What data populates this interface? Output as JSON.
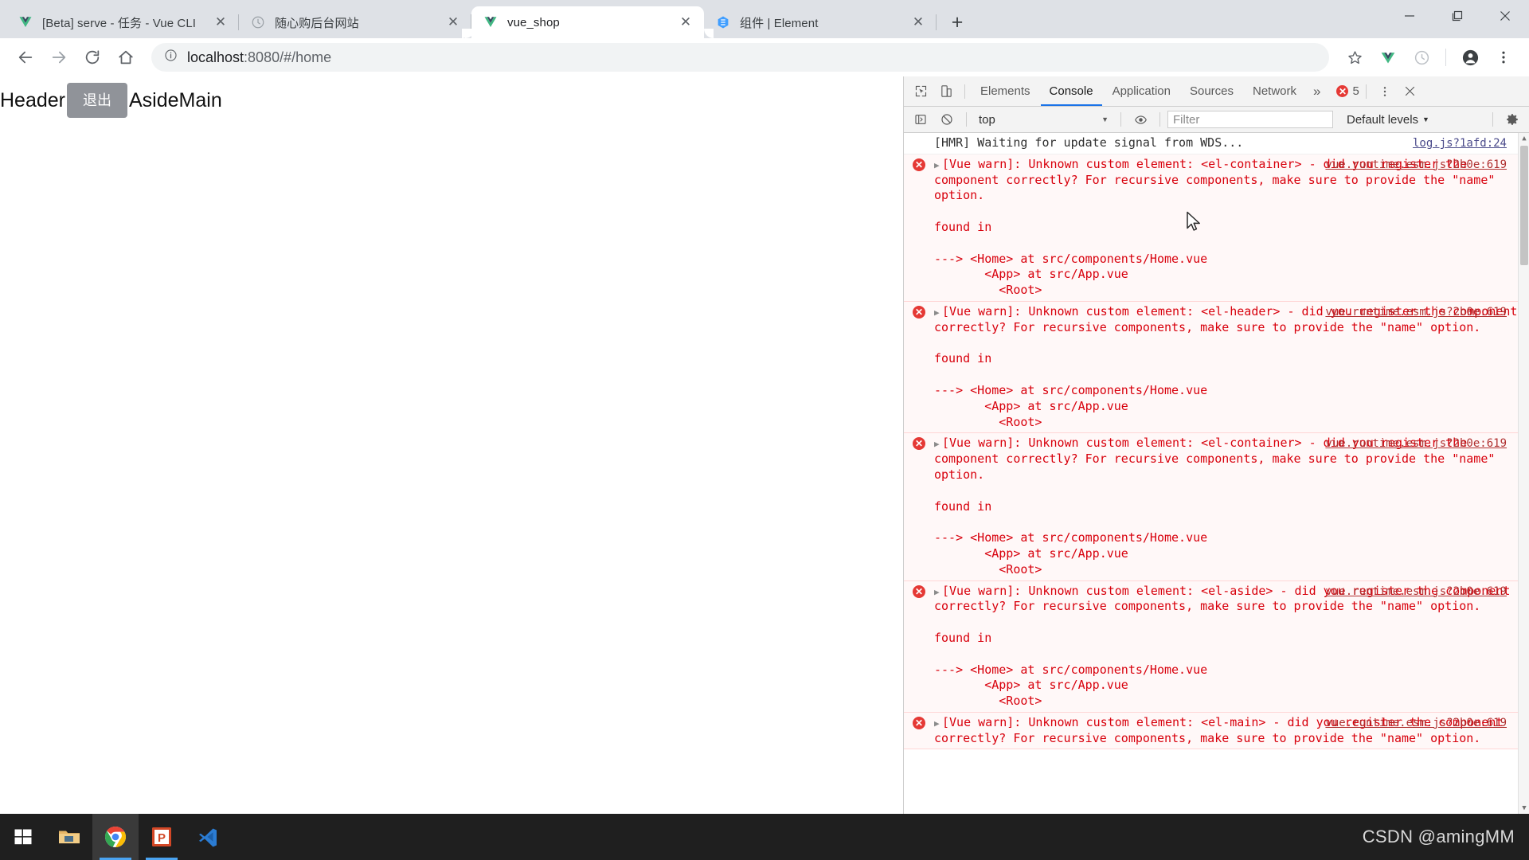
{
  "browser": {
    "tabs": [
      {
        "title": "[Beta] serve - 任务 - Vue CLI",
        "favicon": "vue-icon",
        "active": false
      },
      {
        "title": "随心购后台网站",
        "favicon": "clock-icon",
        "active": false
      },
      {
        "title": "vue_shop",
        "favicon": "vue-icon",
        "active": true
      },
      {
        "title": "组件 | Element",
        "favicon": "element-icon",
        "active": false
      }
    ],
    "newtab_label": "+",
    "window_controls": {
      "minimize": "—",
      "maximize": "❐",
      "close": "✕"
    },
    "toolbar": {
      "back": "←",
      "forward": "→",
      "reload": "⟳",
      "home": "⌂",
      "site_info": "ⓘ",
      "url_host": "localhost",
      "url_path": ":8080/#/home",
      "bookmark": "☆",
      "ext_vue": "vue-devtools-icon",
      "ext_clock": "clock-extension-icon",
      "profile": "profile-avatar",
      "menu": "⋮"
    }
  },
  "page": {
    "header_text": "Header",
    "logout_label": "退出",
    "body_text": "AsideMain"
  },
  "devtools": {
    "inspect_icon": "inspect-element-icon",
    "device_icon": "device-toolbar-icon",
    "panels": [
      "Elements",
      "Console",
      "Application",
      "Sources",
      "Network"
    ],
    "active_panel": "Console",
    "more_panels": "»",
    "error_count": "5",
    "error_badge_glyph": "✕",
    "settings_icon": "⋮",
    "close_icon": "✕",
    "filterbar": {
      "sidebar_toggle": "console-sidebar-icon",
      "clear_icon": "clear-console-icon",
      "context": "top",
      "context_caret": "▼",
      "eye_icon": "live-expression-icon",
      "filter_placeholder": "Filter",
      "filter_value": "",
      "levels": "Default levels",
      "levels_caret": "▼",
      "settings_gear": "settings-gear-icon"
    },
    "messages": [
      {
        "type": "info",
        "text": "[HMR] Waiting for update signal from WDS...",
        "source": "log.js?1afd:24",
        "has_arrow": false
      },
      {
        "type": "warn",
        "text": "[Vue warn]: Unknown custom element: <el-container> - did you register the component correctly? For recursive components, make sure to provide the \"name\" option.\n\nfound in\n\n---> <Home> at src/components/Home.vue\n       <App> at src/App.vue\n         <Root>",
        "source": "vue.runtime.esm.js?2b0e:619",
        "has_arrow": true
      },
      {
        "type": "warn",
        "text": "[Vue warn]: Unknown custom element: <el-header> - did you register the component correctly? For recursive components, make sure to provide the \"name\" option.\n\nfound in\n\n---> <Home> at src/components/Home.vue\n       <App> at src/App.vue\n         <Root>",
        "source": "vue.runtime.esm.js?2b0e:619",
        "has_arrow": true
      },
      {
        "type": "warn",
        "text": "[Vue warn]: Unknown custom element: <el-container> - did you register the component correctly? For recursive components, make sure to provide the \"name\" option.\n\nfound in\n\n---> <Home> at src/components/Home.vue\n       <App> at src/App.vue\n         <Root>",
        "source": "vue.runtime.esm.js?2b0e:619",
        "has_arrow": true
      },
      {
        "type": "warn",
        "text": "[Vue warn]: Unknown custom element: <el-aside> - did you register the component correctly? For recursive components, make sure to provide the \"name\" option.\n\nfound in\n\n---> <Home> at src/components/Home.vue\n       <App> at src/App.vue\n         <Root>",
        "source": "vue.runtime.esm.js?2b0e:619",
        "has_arrow": true
      },
      {
        "type": "warn",
        "text": "[Vue warn]: Unknown custom element: <el-main> - did you register the component correctly? For recursive components, make sure to provide the \"name\" option.",
        "source": "vue.runtime.esm.js?2b0e:619",
        "has_arrow": true
      }
    ]
  },
  "taskbar": {
    "items": [
      {
        "name": "start-button",
        "glyph": "windows-logo-icon",
        "active": false,
        "running": false
      },
      {
        "name": "file-explorer",
        "glyph": "folder-icon",
        "active": false,
        "running": false
      },
      {
        "name": "google-chrome",
        "glyph": "chrome-icon",
        "active": true,
        "running": true
      },
      {
        "name": "powerpoint",
        "glyph": "powerpoint-icon",
        "active": false,
        "running": true
      },
      {
        "name": "visual-studio-code",
        "glyph": "vscode-icon",
        "active": false,
        "running": false
      }
    ],
    "watermark": "CSDN @amingMM"
  },
  "colors": {
    "chrome_frame": "#dee1e6",
    "accent_blue": "#1a73e8",
    "error_red": "#e53935",
    "warn_bg": "#fff8f8",
    "warn_text": "#d8000c",
    "button_gray": "#909399",
    "taskbar_bg": "#1f1f1f"
  }
}
